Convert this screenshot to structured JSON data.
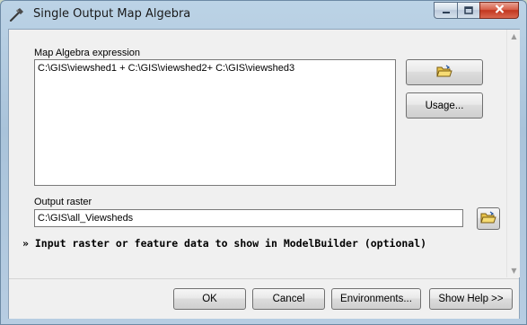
{
  "window": {
    "title": "Single Output Map Algebra",
    "title_icon": "hammer-icon",
    "caption_buttons": [
      "minimize",
      "maximize",
      "close"
    ]
  },
  "form": {
    "expression_label": "Map Algebra expression",
    "expression_value": "C:\\GIS\\viewshed1 + C:\\GIS\\viewshed2+ C:\\GIS\\viewshed3",
    "usage_label": "Usage...",
    "output_label": "Output raster",
    "output_value": "C:\\GIS\\all_Viewsheds",
    "optional_label": "Input raster or feature data to show in ModelBuilder (optional)",
    "optional_icon": "double-chevron-down-icon"
  },
  "footer": {
    "ok_label": "OK",
    "cancel_label": "Cancel",
    "environments_label": "Environments...",
    "show_help_label": "Show Help >>"
  }
}
